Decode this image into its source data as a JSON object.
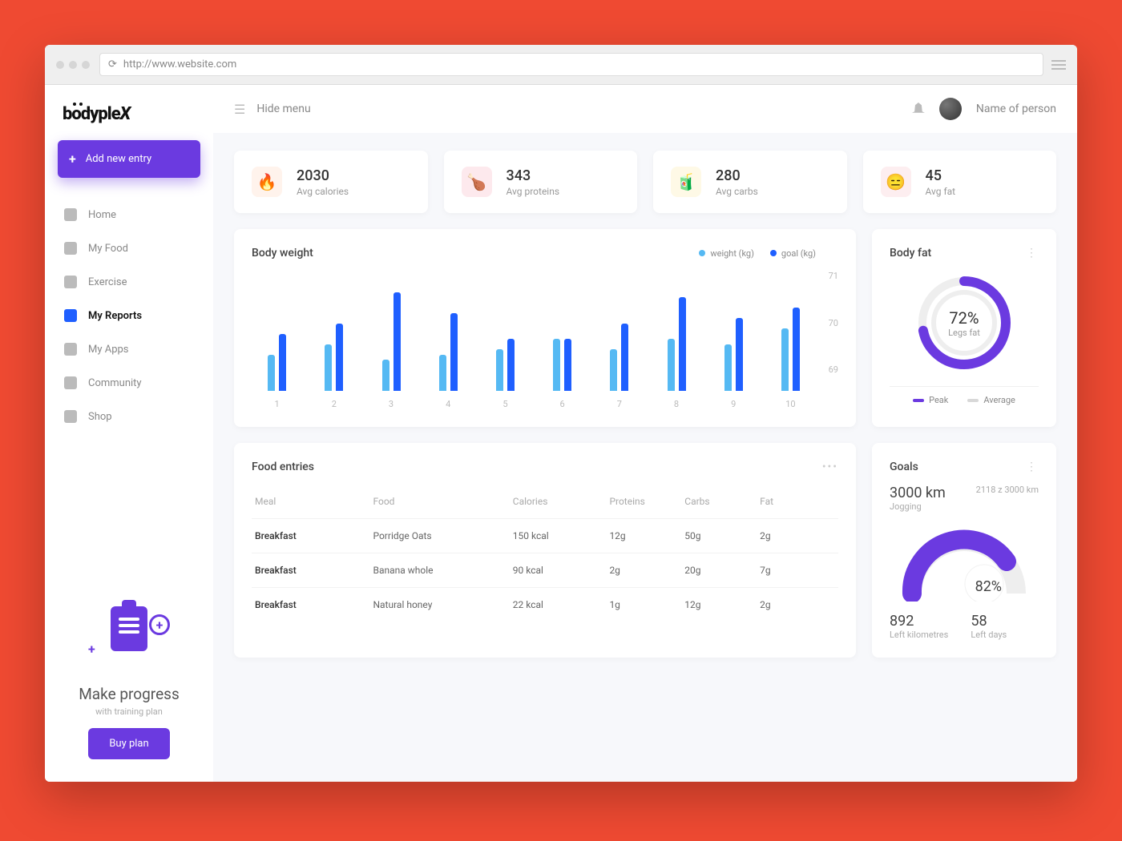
{
  "browser": {
    "url": "http://www.website.com"
  },
  "brand": "bödyplex",
  "add_entry": "Add new entry",
  "hide_menu": "Hide menu",
  "user_name": "Name of person",
  "nav": [
    {
      "label": "Home",
      "icon": "home-icon"
    },
    {
      "label": "My Food",
      "icon": "food-icon"
    },
    {
      "label": "Exercise",
      "icon": "exercise-icon"
    },
    {
      "label": "My Reports",
      "icon": "reports-icon",
      "active": true
    },
    {
      "label": "My Apps",
      "icon": "apps-icon"
    },
    {
      "label": "Community",
      "icon": "community-icon"
    },
    {
      "label": "Shop",
      "icon": "shop-icon"
    }
  ],
  "promo": {
    "title": "Make progress",
    "subtitle": "with training plan",
    "cta": "Buy plan"
  },
  "stats": [
    {
      "icon": "🔥",
      "bg": "cal",
      "value": "2030",
      "label": "Avg calories"
    },
    {
      "icon": "🍗",
      "bg": "pro",
      "value": "343",
      "label": "Avg proteins"
    },
    {
      "icon": "🧃",
      "bg": "carb",
      "value": "280",
      "label": "Avg carbs"
    },
    {
      "icon": "😑",
      "bg": "fat",
      "value": "45",
      "label": "Avg fat"
    }
  ],
  "body_weight": {
    "title": "Body weight",
    "legend": [
      {
        "label": "weight (kg)",
        "color": "#55b9f3"
      },
      {
        "label": "goal (kg)",
        "color": "#1f5fff"
      }
    ]
  },
  "body_fat": {
    "title": "Body fat",
    "percent": "72%",
    "label": "Legs fat",
    "legend": [
      {
        "label": "Peak",
        "color": "#6b3ae0"
      },
      {
        "label": "Average",
        "color": "#d8d8d8"
      }
    ]
  },
  "food_entries": {
    "title": "Food entries",
    "headers": [
      "Meal",
      "Food",
      "Calories",
      "Proteins",
      "Carbs",
      "Fat"
    ],
    "rows": [
      {
        "meal": "Breakfast",
        "food": "Porridge Oats",
        "calories": "150 kcal",
        "proteins": "12g",
        "carbs": "50g",
        "fat": "2g"
      },
      {
        "meal": "Breakfast",
        "food": "Banana whole",
        "calories": "90 kcal",
        "proteins": "2g",
        "carbs": "20g",
        "fat": "7g"
      },
      {
        "meal": "Breakfast",
        "food": "Natural honey",
        "calories": "22 kcal",
        "proteins": "1g",
        "carbs": "12g",
        "fat": "2g"
      }
    ]
  },
  "goals": {
    "title": "Goals",
    "distance": "3000 km",
    "distance_label": "Jogging",
    "range": "2118 z 3000 km",
    "percent": "82%",
    "left_km": "892",
    "left_km_label": "Left kilometres",
    "left_days": "58",
    "left_days_label": "Left days"
  },
  "chart_data": {
    "type": "bar",
    "title": "Body weight",
    "xlabel": "",
    "ylabel": "",
    "ylim": [
      69,
      71
    ],
    "categories": [
      "1",
      "2",
      "3",
      "4",
      "5",
      "6",
      "7",
      "8",
      "9",
      "10"
    ],
    "series": [
      {
        "name": "weight (kg)",
        "color": "#55b9f3",
        "values": [
          69.7,
          69.9,
          69.6,
          69.7,
          69.8,
          70.0,
          69.8,
          70.0,
          69.9,
          70.2
        ]
      },
      {
        "name": "goal (kg)",
        "color": "#1f5fff",
        "values": [
          70.1,
          70.3,
          70.9,
          70.5,
          70.0,
          70.0,
          70.3,
          70.8,
          70.4,
          70.6
        ]
      }
    ]
  }
}
